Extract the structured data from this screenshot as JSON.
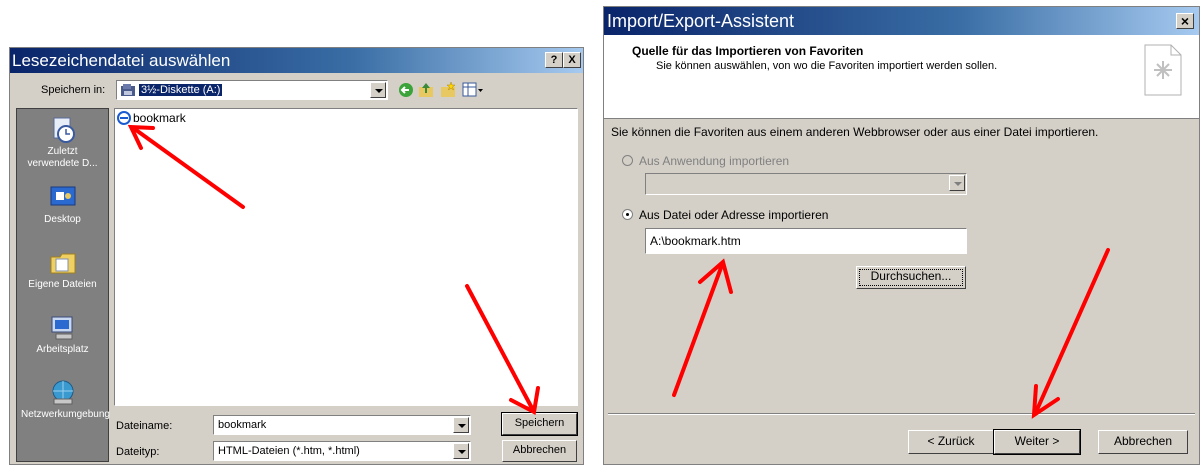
{
  "save_dialog": {
    "title": "Lesezeichendatei auswählen",
    "help_glyph": "?",
    "close_glyph": "X",
    "save_in_label": "Speichern in:",
    "save_in_value": "3½-Diskette (A:)",
    "places": [
      {
        "label": "Zuletzt verwendete D..."
      },
      {
        "label": "Desktop"
      },
      {
        "label": "Eigene Dateien"
      },
      {
        "label": "Arbeitsplatz"
      },
      {
        "label": "Netzwerkumgebung"
      }
    ],
    "files": [
      {
        "name": "bookmark"
      }
    ],
    "filename_label": "Dateiname:",
    "filename_value": "bookmark",
    "filetype_label": "Dateityp:",
    "filetype_value": "HTML-Dateien (*.htm, *.html)",
    "save_button": "Speichern",
    "cancel_button": "Abbrechen"
  },
  "import_wizard": {
    "title": "Import/Export-Assistent",
    "close_glyph": "×",
    "header_title": "Quelle für das Importieren von Favoriten",
    "header_subtitle": "Sie können auswählen, von wo die Favoriten importiert werden sollen.",
    "intro": "Sie können die Favoriten aus einem anderen Webbrowser oder aus einer Datei importieren.",
    "option_app": "Aus Anwendung importieren",
    "app_select_value": "",
    "option_file": "Aus Datei oder Adresse importieren",
    "path_value": "A:\\bookmark.htm",
    "browse_button": "Durchsuchen...",
    "back_button": "< Zurück",
    "next_button": "Weiter >",
    "cancel_button": "Abbrechen"
  },
  "colors": {
    "dialog_face": "#d4d0c8",
    "title_active": "#0a246a",
    "annotation_arrow": "#ff0000"
  }
}
